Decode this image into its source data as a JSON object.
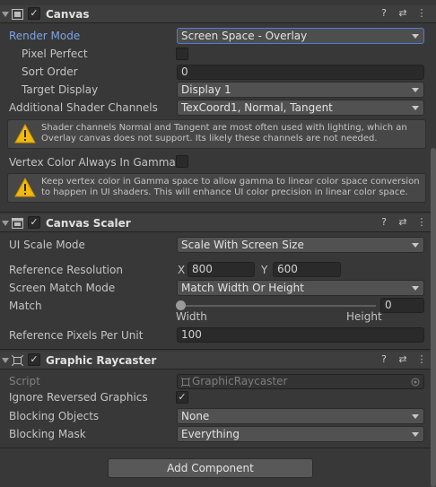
{
  "canvas": {
    "title": "Canvas",
    "render_mode_label": "Render Mode",
    "render_mode_value": "Screen Space - Overlay",
    "pixel_perfect_label": "Pixel Perfect",
    "sort_order_label": "Sort Order",
    "sort_order_value": "0",
    "target_display_label": "Target Display",
    "target_display_value": "Display 1",
    "shader_channels_label": "Additional Shader Channels",
    "shader_channels_value": "TexCoord1, Normal, Tangent",
    "shader_warning": "Shader channels Normal and Tangent are most often used with lighting, which an Overlay canvas does not support. Its likely these channels are not needed.",
    "vertex_color_label": "Vertex Color Always In Gamma C",
    "vertex_warning": "Keep vertex color in Gamma space to allow gamma to linear color space conversion to happen in UI shaders. This will enhance UI color precision in linear color space."
  },
  "canvas_scaler": {
    "title": "Canvas Scaler",
    "ui_scale_mode_label": "UI Scale Mode",
    "ui_scale_mode_value": "Scale With Screen Size",
    "reference_resolution_label": "Reference Resolution",
    "x_label": "X",
    "x_value": "800",
    "y_label": "Y",
    "y_value": "600",
    "screen_match_mode_label": "Screen Match Mode",
    "screen_match_mode_value": "Match Width Or Height",
    "match_label": "Match",
    "match_value": "0",
    "match_fraction": 0,
    "width_label": "Width",
    "height_label": "Height",
    "ref_pixels_label": "Reference Pixels Per Unit",
    "ref_pixels_value": "100"
  },
  "graphic_raycaster": {
    "title": "Graphic Raycaster",
    "script_label": "Script",
    "script_value": "GraphicRaycaster",
    "ignore_reversed_label": "Ignore Reversed Graphics",
    "ignore_reversed_checked": true,
    "blocking_objects_label": "Blocking Objects",
    "blocking_objects_value": "None",
    "blocking_mask_label": "Blocking Mask",
    "blocking_mask_value": "Everything"
  },
  "add_component_label": "Add Component",
  "glyphs": {
    "check": "✓",
    "help": "?",
    "settings": "⇄",
    "more": "⋮"
  },
  "colors": {
    "background": "#383838",
    "header": "#3e3e3e",
    "focus_blue": "#4a7fd4",
    "label_blue": "#7ba4e6"
  }
}
